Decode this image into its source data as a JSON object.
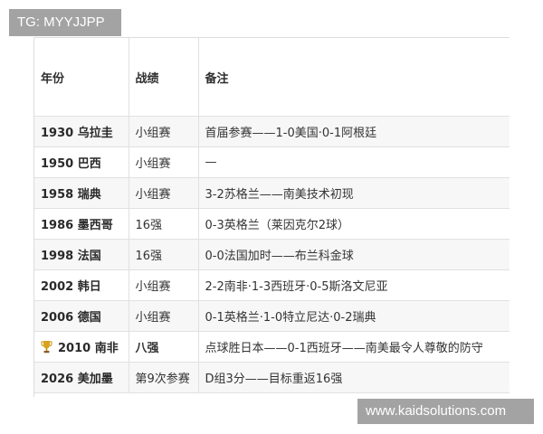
{
  "watermark_top": "TG: MYYJJPP",
  "watermark_bottom": "www.kaidsolutions.com",
  "table": {
    "headers": [
      "年份",
      "战绩",
      "备注"
    ],
    "rows": [
      {
        "year": "1930 乌拉圭",
        "result": "小组赛",
        "note": "首届参赛——1-0美国·0-1阿根廷"
      },
      {
        "year": "1950 巴西",
        "result": "小组赛",
        "note": "—"
      },
      {
        "year": "1958 瑞典",
        "result": "小组赛",
        "note": "3-2苏格兰——南美技术初现"
      },
      {
        "year": "1986 墨西哥",
        "result": "16强",
        "note": "0-3英格兰（莱因克尔2球）"
      },
      {
        "year": "1998 法国",
        "result": "16强",
        "note": "0-0法国加时——布兰科金球"
      },
      {
        "year": "2002 韩日",
        "result": "小组赛",
        "note": "2-2南非·1-3西班牙·0-5斯洛文尼亚"
      },
      {
        "year": "2006 德国",
        "result": "小组赛",
        "note": "0-1英格兰·1-0特立尼达·0-2瑞典"
      },
      {
        "year": "2010 南非",
        "result": "八强",
        "note": "点球胜日本——0-1西班牙——南美最令人尊敬的防守",
        "trophy": "trophy-icon"
      },
      {
        "year": "2026 美加墨",
        "result": "第9次参赛",
        "note": "D组3分——目标重返16强"
      }
    ]
  },
  "colors": {
    "header_text": "#2e2e2e",
    "watermark_bg": "#a3a3a3",
    "row_alt": "#f7f7f7",
    "border": "#e1e1e1"
  }
}
